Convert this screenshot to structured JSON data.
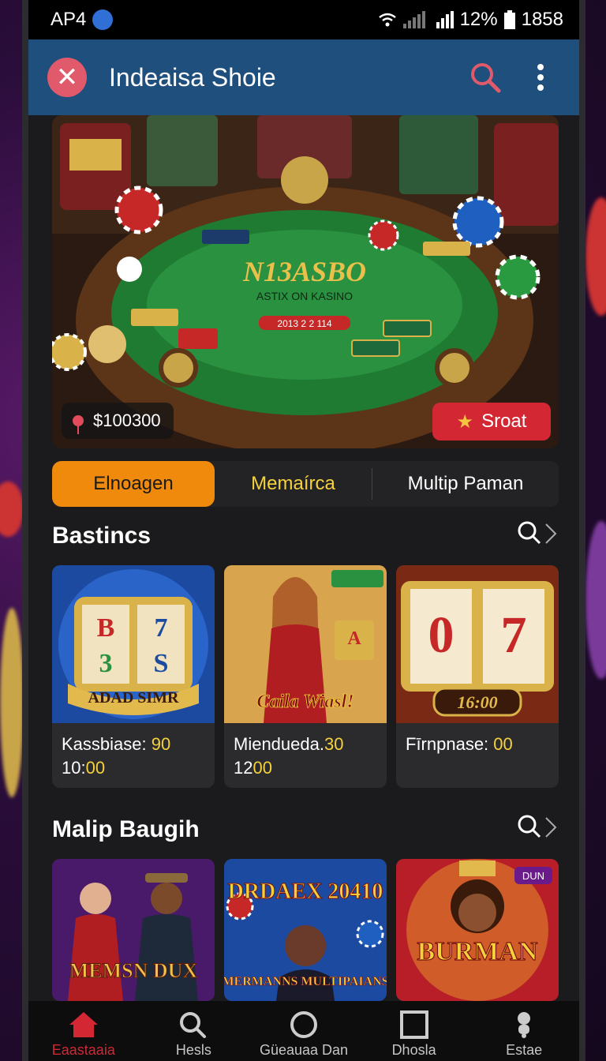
{
  "status_bar": {
    "carrier": "AP4",
    "battery": "12%",
    "time": "1858"
  },
  "app_bar": {
    "title": "Indeaisa Shoie"
  },
  "hero": {
    "title": "N13ASBO",
    "subtitle": "ASTIX ON KASINO",
    "code": "2013 2 2 114",
    "balance": "$100300",
    "start_label": "Sroat"
  },
  "tabs": [
    {
      "label": "Elnoagen"
    },
    {
      "label": "Memaírca"
    },
    {
      "label": "Multip Paman"
    }
  ],
  "section1": {
    "title": "Bastincs",
    "cards": [
      {
        "title_prefix": "Kassbiase:",
        "title_value": "90",
        "line2_prefix": "10:",
        "line2_value": "00",
        "art_text": "ADAD SIMR"
      },
      {
        "title_prefix": "Miendueda.",
        "title_value": "30",
        "line2_prefix": "12",
        "line2_value": "00",
        "art_text": "Caila Wiasl!"
      },
      {
        "title_prefix": "Fīrnpnase:",
        "title_value": "00",
        "line2_prefix": "",
        "line2_value": "",
        "art_text": "16:00"
      }
    ]
  },
  "section2": {
    "title": "Malip Baugih",
    "cards": [
      {
        "art_text": "MEMSN DUX"
      },
      {
        "art_text": "DRDAEX 20410",
        "art_sub": "MERMANNS MULTIPAIANS"
      },
      {
        "art_text": "BURMAN",
        "badge": "DUN"
      }
    ]
  },
  "bottom_nav": [
    {
      "label": "Eaastaaia",
      "icon": "home-icon"
    },
    {
      "label": "Hesls",
      "icon": "search-icon"
    },
    {
      "label": "Güeauaa Dan",
      "icon": "circle-icon"
    },
    {
      "label": "Dhosla",
      "icon": "square-icon"
    },
    {
      "label": "Estae",
      "icon": "person-icon"
    }
  ],
  "colors": {
    "accent": "#f08a0c",
    "brand": "#1f4f7c",
    "start": "#d32733",
    "highlight": "#f5d23c"
  }
}
